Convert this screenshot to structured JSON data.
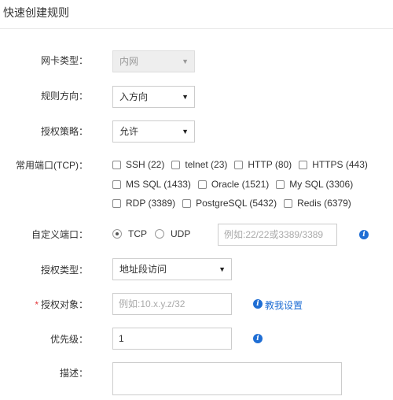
{
  "page": {
    "title": "快速创建规则"
  },
  "form": {
    "nic_type": {
      "label": "网卡类型：",
      "value": "内网"
    },
    "direction": {
      "label": "规则方向：",
      "value": "入方向"
    },
    "policy": {
      "label": "授权策略：",
      "value": "允许"
    },
    "common_ports": {
      "label": "常用端口(TCP)：",
      "options": [
        [
          "SSH (22)",
          "telnet (23)",
          "HTTP (80)",
          "HTTPS (443)"
        ],
        [
          "MS SQL (1433)",
          "Oracle (1521)",
          "My SQL (3306)"
        ],
        [
          "RDP (3389)",
          "PostgreSQL (5432)",
          "Redis (6379)"
        ]
      ]
    },
    "custom_port": {
      "label": "自定义端口：",
      "protocols": [
        "TCP",
        "UDP"
      ],
      "selected": "TCP",
      "placeholder": "例如:22/22或3389/3389"
    },
    "auth_type": {
      "label": "授权类型：",
      "value": "地址段访问"
    },
    "auth_object": {
      "label": "授权对象：",
      "required_mark": "*",
      "placeholder": "例如:10.x.y.z/32",
      "help_link": "教我设置"
    },
    "priority": {
      "label": "优先级：",
      "value": "1"
    },
    "description": {
      "label": "描述：",
      "value": ""
    }
  },
  "icons": {
    "info": "info-icon",
    "dropdown": "caret-down-icon"
  },
  "colors": {
    "accent": "#1f6ed4",
    "required": "#e4393c"
  }
}
